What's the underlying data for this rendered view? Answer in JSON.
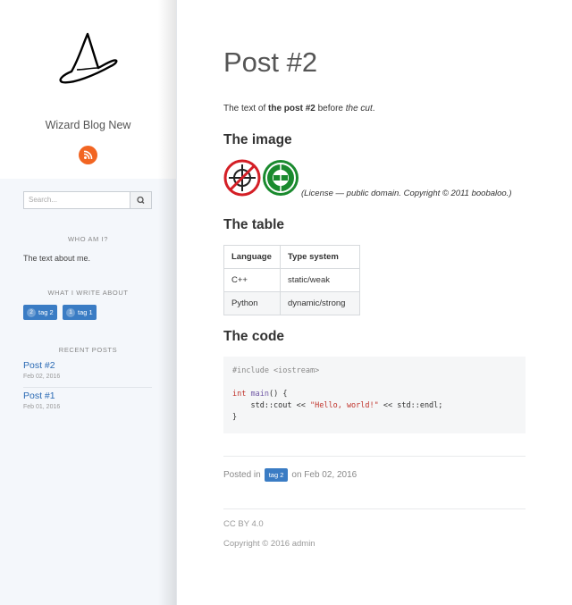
{
  "sidebar": {
    "blog_name": "Wizard Blog New",
    "search_placeholder": "Search...",
    "widgets": {
      "about_title": "WHO AM I?",
      "about_text": "The text about me.",
      "tags_title": "WHAT I WRITE ABOUT",
      "tags": [
        {
          "count": "2",
          "label": "tag 2"
        },
        {
          "count": "1",
          "label": "tag 1"
        }
      ],
      "recent_title": "RECENT POSTS",
      "recent": [
        {
          "title": "Post #2",
          "date": "Feb 02, 2016"
        },
        {
          "title": "Post #1",
          "date": "Feb 01, 2016"
        }
      ]
    },
    "icons": {
      "logo": "wizard-hat-icon",
      "rss": "rss-icon",
      "search": "search-icon"
    },
    "colors": {
      "rss": "#f26522",
      "tag": "#3a7cc4",
      "link": "#2a6ab4"
    }
  },
  "post": {
    "title": "Post #2",
    "intro_prefix": "The text of ",
    "intro_bold": "the post #2",
    "intro_mid": " before ",
    "intro_italic": "the cut",
    "intro_suffix": ".",
    "image_heading": "The image",
    "image_caption": "(License — public domain. Copyright © 2011 boobaloo.)",
    "table_heading": "The table",
    "table": {
      "headers": [
        "Language",
        "Type system"
      ],
      "rows": [
        [
          "C++",
          "static/weak"
        ],
        [
          "Python",
          "dynamic/strong"
        ]
      ]
    },
    "code_heading": "The code",
    "code": {
      "line1": "#include <iostream>",
      "kw": "int",
      "fn": "main",
      "sig_rest": "() {",
      "body_pre": "    std::cout << ",
      "body_str": "\"Hello, world!\"",
      "body_post": " << std::endl;",
      "close": "}"
    },
    "posted_prefix": "Posted in",
    "posted_tag": "tag 2",
    "posted_suffix": "on Feb 02, 2016"
  },
  "footer": {
    "license": "CC BY 4.0",
    "copyright": "Copyright © 2016 admin"
  }
}
